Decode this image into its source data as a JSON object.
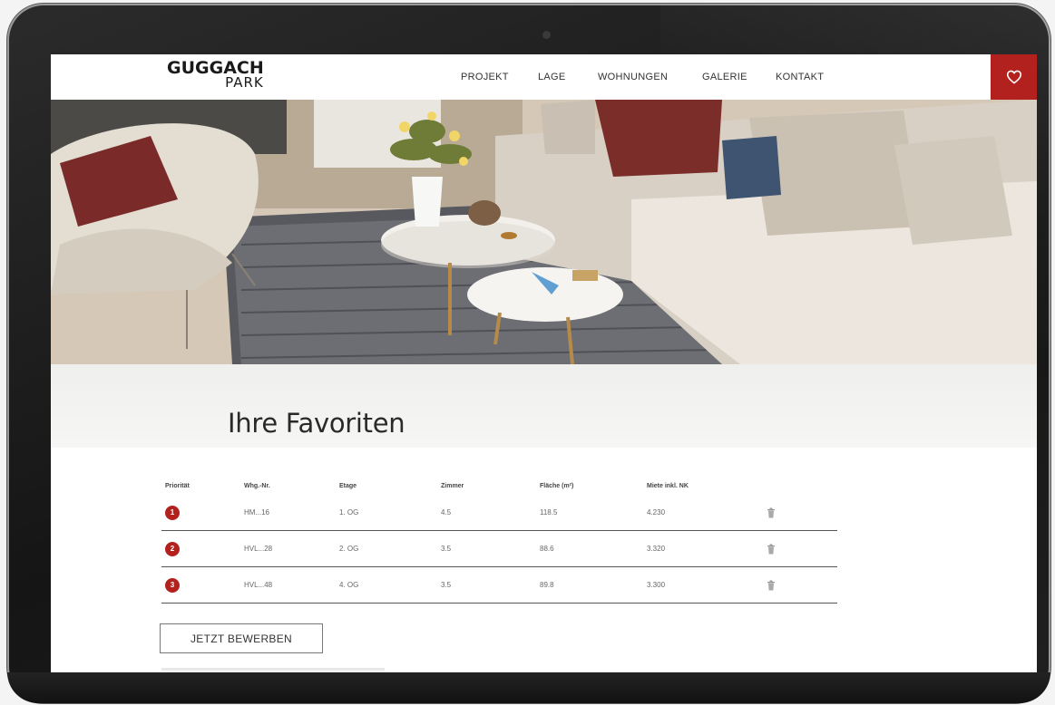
{
  "brand": {
    "logo_line1": "GUGGACH",
    "logo_line2": "PARK"
  },
  "nav": {
    "items": [
      "PROJEKT",
      "LAGE",
      "WOHNUNGEN",
      "GALERIE",
      "KONTAKT"
    ]
  },
  "colors": {
    "accent": "#b3211e"
  },
  "icons": {
    "favorites": "heart-icon",
    "remove": "trash-icon"
  },
  "favorites": {
    "title": "Ihre Favoriten",
    "columns": [
      "Priorität",
      "Whg.-Nr.",
      "Etage",
      "Zimmer",
      "Fläche (m²)",
      "Miete inkl. NK"
    ],
    "rows": [
      {
        "priority": "1",
        "unit": "HM...16",
        "floor": "1. OG",
        "rooms": "4.5",
        "area": "118.5",
        "rent": "4.230"
      },
      {
        "priority": "2",
        "unit": "HVL...28",
        "floor": "2. OG",
        "rooms": "3.5",
        "area": "88.6",
        "rent": "3.320"
      },
      {
        "priority": "3",
        "unit": "HVL...48",
        "floor": "4. OG",
        "rooms": "3.5",
        "area": "89.8",
        "rent": "3.300"
      }
    ],
    "apply_label": "JETZT BEWERBEN"
  }
}
